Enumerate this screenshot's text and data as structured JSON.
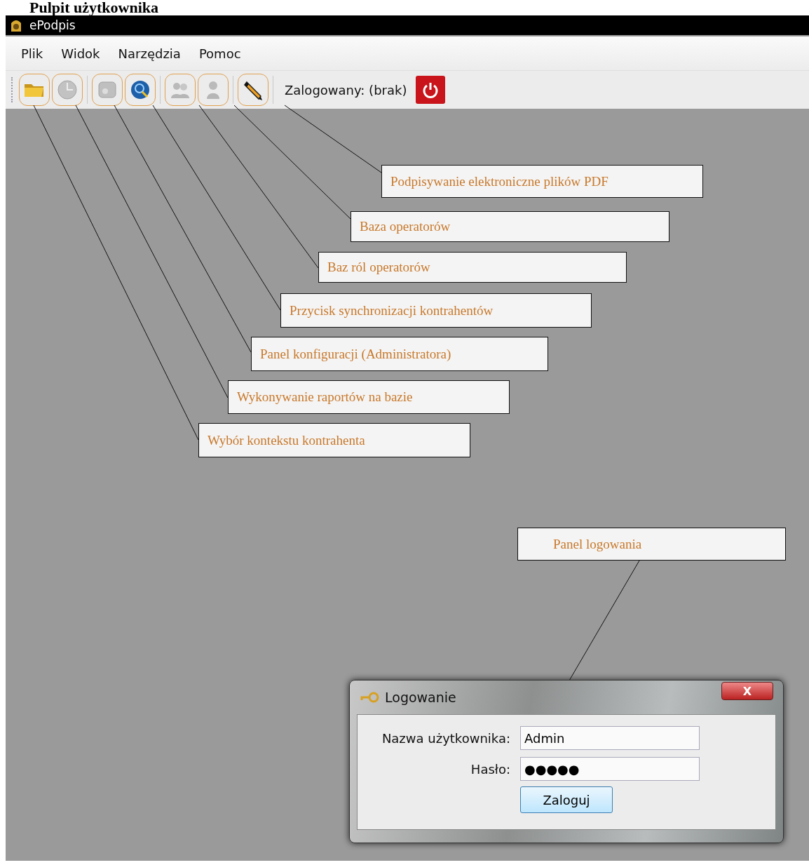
{
  "page_heading": "Pulpit użytkownika",
  "window": {
    "title": "ePodpis"
  },
  "menu": [
    "Plik",
    "Widok",
    "Narzędzia",
    "Pomoc"
  ],
  "toolbar": {
    "tools": [
      {
        "kind": "folder",
        "disabled": false
      },
      {
        "kind": "clock",
        "disabled": true
      },
      {
        "kind": "box",
        "disabled": true
      },
      {
        "kind": "globe",
        "disabled": false
      },
      {
        "kind": "users",
        "disabled": true
      },
      {
        "kind": "user",
        "disabled": true
      },
      {
        "kind": "pencil",
        "disabled": false
      }
    ],
    "login_status": "Zalogowany: (brak)"
  },
  "callouts": [
    {
      "text": "Podpisywanie elektroniczne plików PDF"
    },
    {
      "text": "Baza operatorów"
    },
    {
      "text": "Baz ról operatorów"
    },
    {
      "text": "Przycisk synchronizacji kontrahentów"
    },
    {
      "text": "Panel konfiguracji (Administratora)"
    },
    {
      "text": "Wykonywanie raportów na bazie"
    },
    {
      "text": "Wybór kontekstu kontrahenta"
    },
    {
      "text": "Panel logowania"
    }
  ],
  "login_dialog": {
    "title": "Logowanie",
    "close": "X",
    "fields": [
      {
        "label": "Nazwa użytkownika:",
        "value": "Admin"
      },
      {
        "label": "Hasło:",
        "value": "●●●●●"
      }
    ],
    "button": "Zaloguj"
  }
}
